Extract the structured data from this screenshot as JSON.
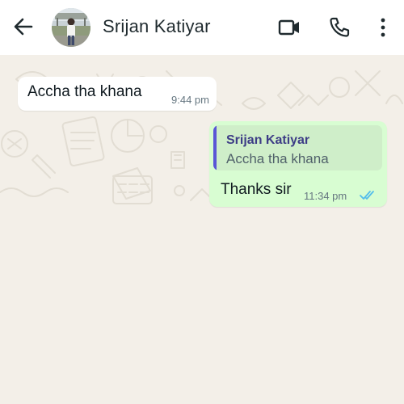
{
  "header": {
    "contact_name": "Srijan Katiyar",
    "icons": {
      "back": "arrow-left-icon",
      "avatar": "avatar",
      "video": "video-call-icon",
      "call": "phone-icon",
      "menu": "more-vertical-icon"
    }
  },
  "messages": [
    {
      "direction": "incoming",
      "text": "Accha tha khana",
      "time": "9:44 pm"
    },
    {
      "direction": "outgoing",
      "reply_to": {
        "author": "Srijan Katiyar",
        "text": "Accha tha khana"
      },
      "text": "Thanks sir",
      "time": "11:34 pm",
      "status": "read"
    }
  ],
  "colors": {
    "chat_background": "#f3efe8",
    "incoming_bubble": "#ffffff",
    "outgoing_bubble": "#d8fdd2",
    "quote_bar": "#5a56d6",
    "read_ticks": "#53bdeb"
  }
}
